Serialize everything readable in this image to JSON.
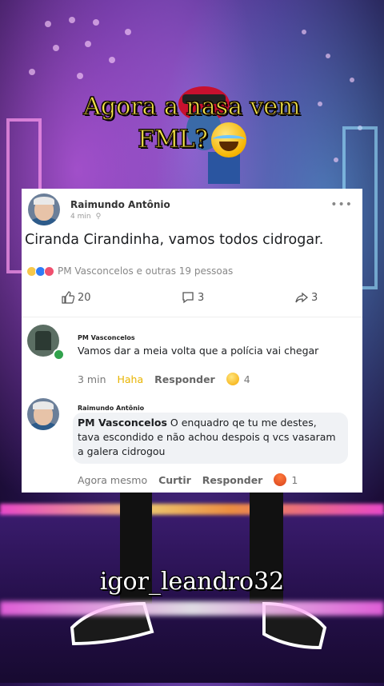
{
  "caption": {
    "line1": "Agora a nasa vem",
    "line2": "FML?"
  },
  "post": {
    "author": "Raimundo Antônio",
    "time": "4 min",
    "text": "Ciranda Cirandinha, vamos todos cidrogar.",
    "reactions_summary": "PM Vasconcelos e outras 19 pessoas",
    "likes": "20",
    "comments": "3",
    "shares": "3",
    "more_icon": "more-dots-icon"
  },
  "comments": [
    {
      "author": "PM Vasconcelos",
      "text": "Vamos dar a meia volta que a polícia vai chegar",
      "time": "3 min",
      "reaction_label": "Haha",
      "reply_label": "Responder",
      "reaction_count": "4"
    },
    {
      "author": "Raimundo Antônio",
      "mention": "PM Vasconcelos",
      "text": " O enquadro qe tu me destes, tava escondido e não achou despois q vcs vasaram a galera cidrogou",
      "time": "Agora mesmo",
      "like_label": "Curtir",
      "reply_label": "Responder",
      "reaction_count": "1"
    }
  ],
  "watermark": "igor_leandro32",
  "colors": {
    "caption": "#f4e84c",
    "haha": "#e8b400",
    "online": "#31a24c"
  }
}
